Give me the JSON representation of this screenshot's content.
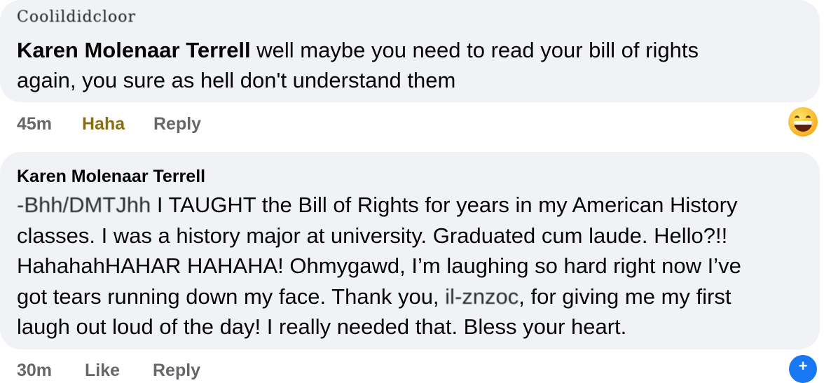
{
  "comment_1": {
    "redacted_header": "Coolildidcloor",
    "author": "Karen Molenaar Terrell",
    "text_line_1": " well maybe you need to read your bill of rights",
    "text_line_2": "again, you sure as hell don't understand them"
  },
  "comment_1_actions": {
    "time": "45m",
    "haha": "Haha",
    "reply": "Reply"
  },
  "reaction_icon": "laughing-face-emoji",
  "comment_2": {
    "author": "Karen Molenaar Terrell",
    "redacted_mention": "-Bhh/DMTJhh",
    "text_line_1": " I TAUGHT the Bill of Rights for years in my American History",
    "text_line_2": "classes. I was a history major at university. Graduated cum laude. Hello?!!",
    "text_line_3": "HahahahHAHAR HAHAHA! Ohmygawd, I’m laughing so hard right now I’ve",
    "text_line_4_a": "got tears running down my face. Thank you, ",
    "redacted_name": "il-znzoc",
    "text_line_4_b": ", for giving me my first",
    "text_line_5": "laugh out loud of the day! I really needed that. Bless your heart."
  },
  "comment_2_actions_partial": {
    "time": "30m",
    "like": "Like",
    "reply": "Reply"
  },
  "colors": {
    "bubble": "#f0f2f5",
    "text": "#050505",
    "meta": "#65676b",
    "haha": "#8a6f10",
    "accent": "#1877f2"
  }
}
